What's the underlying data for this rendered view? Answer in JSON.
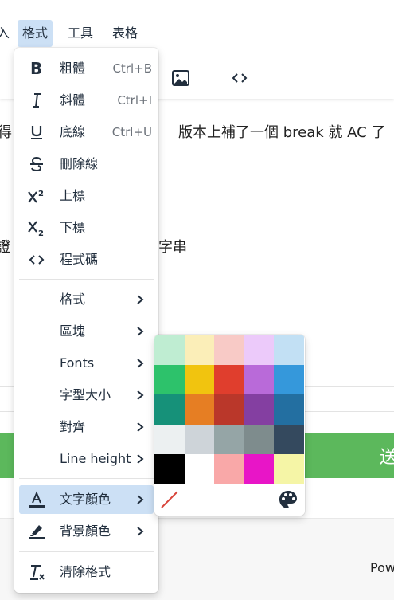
{
  "menubar": {
    "items": [
      {
        "label": "入"
      },
      {
        "label": "格式",
        "active": true
      },
      {
        "label": "工具"
      },
      {
        "label": "表格"
      }
    ]
  },
  "toolbar": {
    "buttons": [
      {
        "icon": "image-icon"
      },
      {
        "icon": "code-icon"
      }
    ]
  },
  "content": {
    "line1_left": "得",
    "line1_right": "版本上補了一個 break 就 AC 了",
    "line2_left": "證",
    "line2_right": "字串"
  },
  "footer": {
    "green_bar_text": "送",
    "powered_text": "Pow"
  },
  "format_menu": {
    "items": [
      {
        "label": "粗體",
        "shortcut": "Ctrl+B",
        "icon": "bold-icon"
      },
      {
        "label": "斜體",
        "shortcut": "Ctrl+I",
        "icon": "italic-icon"
      },
      {
        "label": "底線",
        "shortcut": "Ctrl+U",
        "icon": "underline-icon"
      },
      {
        "label": "刪除線",
        "shortcut": "",
        "icon": "strikethrough-icon"
      },
      {
        "label": "上標",
        "shortcut": "",
        "icon": "superscript-icon"
      },
      {
        "label": "下標",
        "shortcut": "",
        "icon": "subscript-icon"
      },
      {
        "label": "程式碼",
        "shortcut": "",
        "icon": "code-icon"
      }
    ],
    "submenus": [
      {
        "label": "格式"
      },
      {
        "label": "區塊"
      },
      {
        "label": "Fonts"
      },
      {
        "label": "字型大小"
      },
      {
        "label": "對齊"
      },
      {
        "label": "Line height"
      }
    ],
    "color_items": [
      {
        "label": "文字顏色",
        "icon": "text-color-icon",
        "active": true
      },
      {
        "label": "背景顏色",
        "icon": "highlight-color-icon",
        "active": false
      }
    ],
    "clear_label": "清除格式"
  },
  "colors": {
    "swatches": [
      "#bfedd2",
      "#fbeeb8",
      "#f8cac6",
      "#eccafa",
      "#c2e0f4",
      "#2dc26b",
      "#f1c40f",
      "#e03e2d",
      "#b96ad9",
      "#3598db",
      "#169179",
      "#e67e23",
      "#ba372a",
      "#843fa1",
      "#236fa1",
      "#ecf0f1",
      "#ced4d9",
      "#95a5a6",
      "#7e8c8d",
      "#34495e",
      "#000000",
      "#ffffff",
      "#f9a8a8",
      "#e815c7",
      "#f5f5a6"
    ],
    "accent": "#cce0f5",
    "icon_color": "#222f3e",
    "green_bar": "#5cb85c"
  }
}
